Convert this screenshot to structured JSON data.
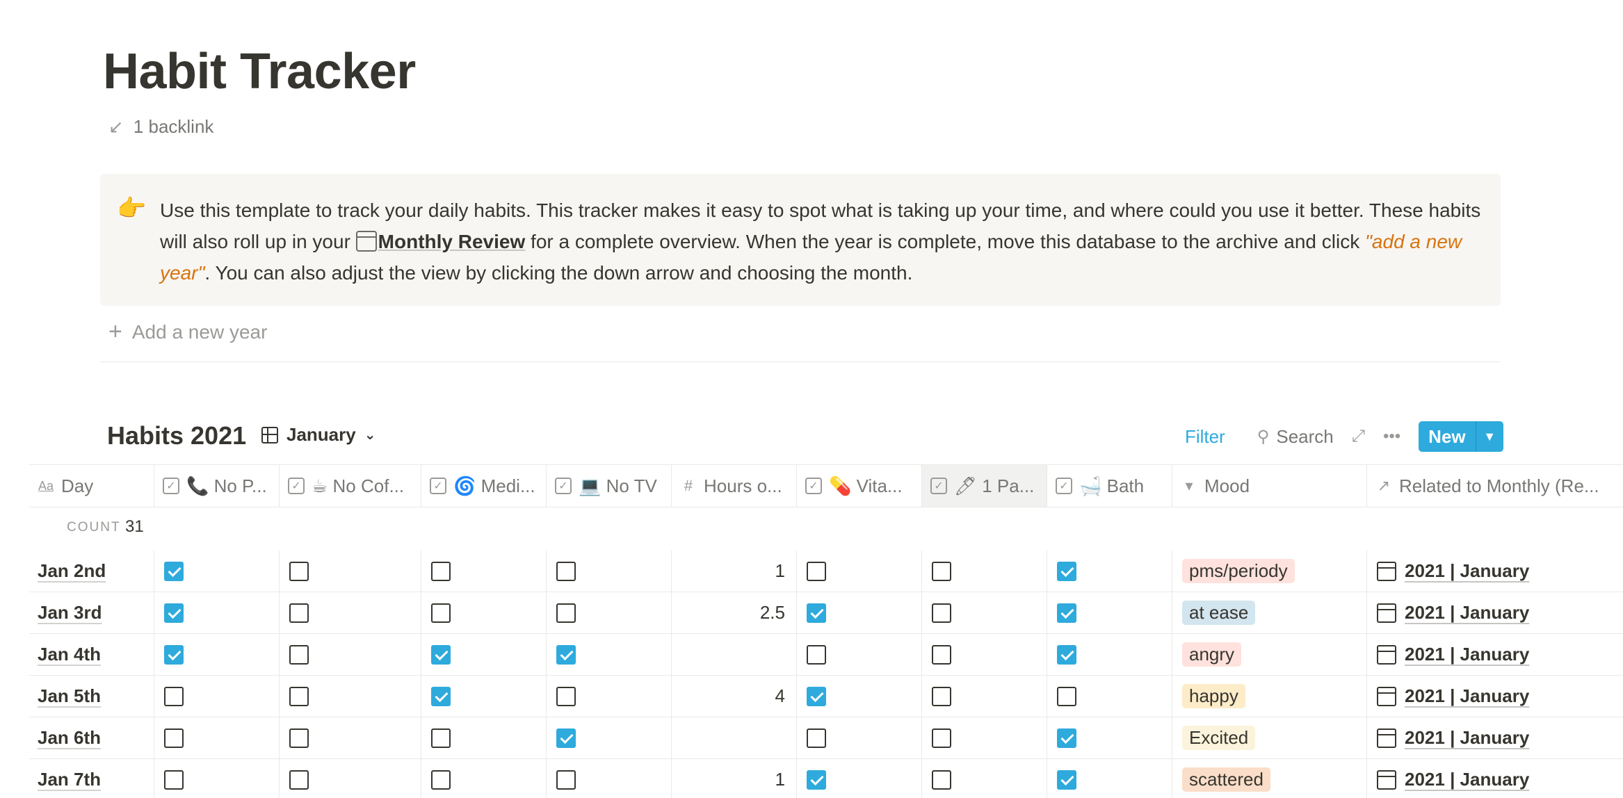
{
  "page": {
    "title": "Habit Tracker",
    "backlink": "1 backlink"
  },
  "callout": {
    "emoji": "👉",
    "text_1": "Use this template to track your daily habits. This tracker makes it easy to spot what is taking up your time, and where could you use it better. These habits will also roll up in your ",
    "mention": "Monthly Review",
    "text_2": " for a complete overview. When the year is complete, move this database to the archive and click ",
    "highlight": "\"add a new year\"",
    "text_3": ". You can also adjust the view by clicking the down arrow and choosing the month."
  },
  "add_year": "Add a new year",
  "database": {
    "title": "Habits 2021",
    "view": "January",
    "filter": "Filter",
    "search": "Search",
    "new": "New"
  },
  "columns": [
    {
      "label": "Day",
      "icon": "text-property-icon"
    },
    {
      "label": "📞 No P...",
      "icon": "checkbox-property-icon"
    },
    {
      "label": "☕ No Cof...",
      "icon": "checkbox-property-icon"
    },
    {
      "label": "🌀 Medi...",
      "icon": "checkbox-property-icon"
    },
    {
      "label": "💻 No TV",
      "icon": "checkbox-property-icon"
    },
    {
      "label": "Hours o...",
      "icon": "number-property-icon"
    },
    {
      "label": "💊 Vita...",
      "icon": "checkbox-property-icon"
    },
    {
      "label": "🖊 1 Pa...",
      "icon": "checkbox-property-icon"
    },
    {
      "label": "🛁 Bath",
      "icon": "checkbox-property-icon"
    },
    {
      "label": "Mood",
      "icon": "select-property-icon"
    },
    {
      "label": "Related to Monthly (Re...",
      "icon": "relation-property-icon"
    }
  ],
  "count": {
    "label": "COUNT",
    "value": "31"
  },
  "rows": [
    {
      "day": "Jan 2nd",
      "checks": [
        true,
        false,
        false,
        false
      ],
      "hours": "1",
      "checks2": [
        false,
        false,
        true
      ],
      "mood": "pms/periody",
      "mood_color": "#ffe2dd",
      "related": "2021 | January"
    },
    {
      "day": "Jan 3rd",
      "checks": [
        true,
        false,
        false,
        false
      ],
      "hours": "2.5",
      "checks2": [
        true,
        false,
        true
      ],
      "mood": "at ease",
      "mood_color": "#d3e5ef",
      "related": "2021 | January"
    },
    {
      "day": "Jan 4th",
      "checks": [
        true,
        false,
        true,
        true
      ],
      "hours": "",
      "checks2": [
        false,
        false,
        true
      ],
      "mood": "angry",
      "mood_color": "#ffe2dd",
      "related": "2021 | January"
    },
    {
      "day": "Jan 5th",
      "checks": [
        false,
        false,
        true,
        false
      ],
      "hours": "4",
      "checks2": [
        true,
        false,
        false
      ],
      "mood": "happy",
      "mood_color": "#fdecc8",
      "related": "2021 | January"
    },
    {
      "day": "Jan 6th",
      "checks": [
        false,
        false,
        false,
        true
      ],
      "hours": "",
      "checks2": [
        false,
        false,
        true
      ],
      "mood": "Excited",
      "mood_color": "#fbf3db",
      "related": "2021 | January"
    },
    {
      "day": "Jan 7th",
      "checks": [
        false,
        false,
        false,
        false
      ],
      "hours": "1",
      "checks2": [
        true,
        false,
        true
      ],
      "mood": "scattered",
      "mood_color": "#fadec9",
      "related": "2021 | January"
    }
  ],
  "colors": {
    "accent": "#2eaadc",
    "text": "#37352f",
    "muted": "#787774"
  }
}
